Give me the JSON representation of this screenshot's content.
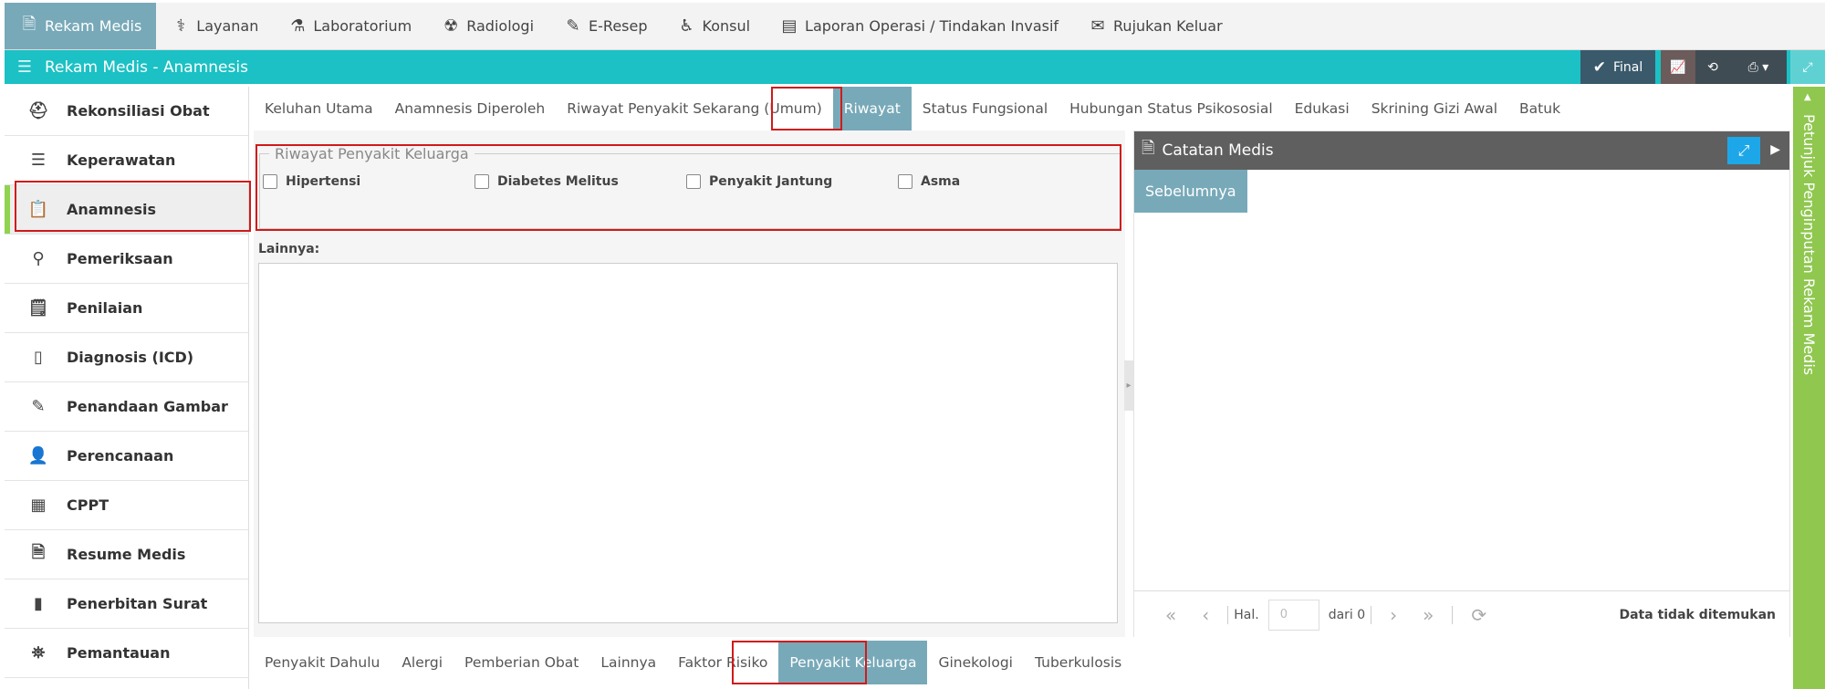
{
  "topnav": {
    "items": [
      {
        "label": "Rekam Medis",
        "icon": "document-icon",
        "glyph": "🗎"
      },
      {
        "label": "Layanan",
        "icon": "doctor-icon",
        "glyph": "⚕"
      },
      {
        "label": "Laboratorium",
        "icon": "flask-icon",
        "glyph": "⚗"
      },
      {
        "label": "Radiologi",
        "icon": "xray-icon",
        "glyph": "☢"
      },
      {
        "label": "E-Resep",
        "icon": "eraser-icon",
        "glyph": "✎"
      },
      {
        "label": "Konsul",
        "icon": "wheelchair-icon",
        "glyph": "♿"
      },
      {
        "label": "Laporan Operasi / Tindakan Invasif",
        "icon": "newspaper-icon",
        "glyph": "▤"
      },
      {
        "label": "Rujukan Keluar",
        "icon": "envelope-icon",
        "glyph": "✉"
      }
    ]
  },
  "header": {
    "title": "Rekam Medis - Anamnesis",
    "final_label": "Final"
  },
  "sidebar": {
    "items": [
      {
        "label": "Rekonsiliasi Obat",
        "icon": "medkit-icon",
        "glyph": "⛑"
      },
      {
        "label": "Keperawatan",
        "icon": "list-icon",
        "glyph": "☰"
      },
      {
        "label": "Anamnesis",
        "icon": "clipboard-icon",
        "glyph": "📋"
      },
      {
        "label": "Pemeriksaan",
        "icon": "stethoscope-icon",
        "glyph": "⚲"
      },
      {
        "label": "Penilaian",
        "icon": "assessment-icon",
        "glyph": "🗒"
      },
      {
        "label": "Diagnosis (ICD)",
        "icon": "device-icon",
        "glyph": "▯"
      },
      {
        "label": "Penandaan Gambar",
        "icon": "edit-icon",
        "glyph": "✎"
      },
      {
        "label": "Perencanaan",
        "icon": "user-plan-icon",
        "glyph": "👤"
      },
      {
        "label": "CPPT",
        "icon": "chart-doc-icon",
        "glyph": "▦"
      },
      {
        "label": "Resume Medis",
        "icon": "file-text-icon",
        "glyph": "🗎"
      },
      {
        "label": "Penerbitan Surat",
        "icon": "file-icon",
        "glyph": "▮"
      },
      {
        "label": "Pemantauan",
        "icon": "binoculars-icon",
        "glyph": "⛯"
      }
    ]
  },
  "tabs": [
    "Keluhan Utama",
    "Anamnesis Diperoleh",
    "Riwayat Penyakit Sekarang (Umum)",
    "Riwayat",
    "Status Fungsional",
    "Hubungan Status Psikososial",
    "Edukasi",
    "Skrining Gizi Awal",
    "Batuk"
  ],
  "form": {
    "legend": "Riwayat Penyakit Keluarga",
    "checkboxes": [
      "Hipertensi",
      "Diabetes Melitus",
      "Penyakit Jantung",
      "Asma"
    ],
    "other_label": "Lainnya:"
  },
  "right_panel": {
    "title": "Catatan Medis",
    "tab": "Sebelumnya",
    "page_label": "Hal.",
    "page_value": "0",
    "of_label": "dari 0",
    "empty_text": "Data tidak ditemukan"
  },
  "side_panel": {
    "label": "Petunjuk Penginputan Rekam Medis"
  },
  "bottom_tabs": [
    "Penyakit Dahulu",
    "Alergi",
    "Pemberian Obat",
    "Lainnya",
    "Faktor Risiko",
    "Penyakit Keluarga",
    "Ginekologi",
    "Tuberkulosis"
  ]
}
